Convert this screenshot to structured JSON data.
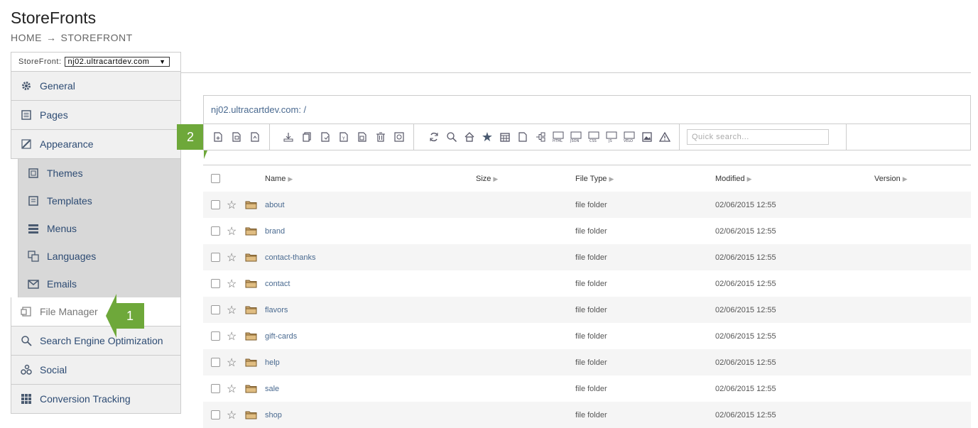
{
  "header": {
    "title": "StoreFronts",
    "breadcrumb": [
      "HOME",
      "→",
      "STOREFRONT"
    ]
  },
  "storefront_selector": {
    "label": "StoreFront:",
    "value": "nj02.ultracartdev.com"
  },
  "sidebar": {
    "items": [
      {
        "label": "General",
        "icon": "gear-icon"
      },
      {
        "label": "Pages",
        "icon": "pages-icon"
      },
      {
        "label": "Appearance",
        "icon": "brush-icon"
      }
    ],
    "sub_items": [
      {
        "label": "Themes",
        "icon": "themes-icon"
      },
      {
        "label": "Templates",
        "icon": "templates-icon"
      },
      {
        "label": "Menus",
        "icon": "menu-icon"
      },
      {
        "label": "Languages",
        "icon": "languages-icon"
      },
      {
        "label": "Emails",
        "icon": "email-icon"
      }
    ],
    "after": [
      {
        "label": "File Manager",
        "icon": "file-manager-icon",
        "active": true
      },
      {
        "label": "Search Engine Optimization",
        "icon": "search-icon"
      },
      {
        "label": "Social",
        "icon": "social-icon"
      },
      {
        "label": "Conversion Tracking",
        "icon": "grid-icon"
      }
    ]
  },
  "callouts": {
    "one": "1",
    "two": "2"
  },
  "file_manager": {
    "path": "nj02.ultracartdev.com: /",
    "search_placeholder": "Quick search...",
    "columns": {
      "name": "Name",
      "size": "Size",
      "type": "File Type",
      "modified": "Modified",
      "version": "Version"
    },
    "rows": [
      {
        "name": "about",
        "type": "file folder",
        "modified": "02/06/2015 12:55"
      },
      {
        "name": "brand",
        "type": "file folder",
        "modified": "02/06/2015 12:55"
      },
      {
        "name": "contact-thanks",
        "type": "file folder",
        "modified": "02/06/2015 12:55"
      },
      {
        "name": "contact",
        "type": "file folder",
        "modified": "02/06/2015 12:55"
      },
      {
        "name": "flavors",
        "type": "file folder",
        "modified": "02/06/2015 12:55"
      },
      {
        "name": "gift-cards",
        "type": "file folder",
        "modified": "02/06/2015 12:55"
      },
      {
        "name": "help",
        "type": "file folder",
        "modified": "02/06/2015 12:55"
      },
      {
        "name": "sale",
        "type": "file folder",
        "modified": "02/06/2015 12:55"
      },
      {
        "name": "shop",
        "type": "file folder",
        "modified": "02/06/2015 12:55"
      }
    ]
  },
  "colors": {
    "accent_green": "#6ea83a",
    "link": "#4a6a90"
  }
}
